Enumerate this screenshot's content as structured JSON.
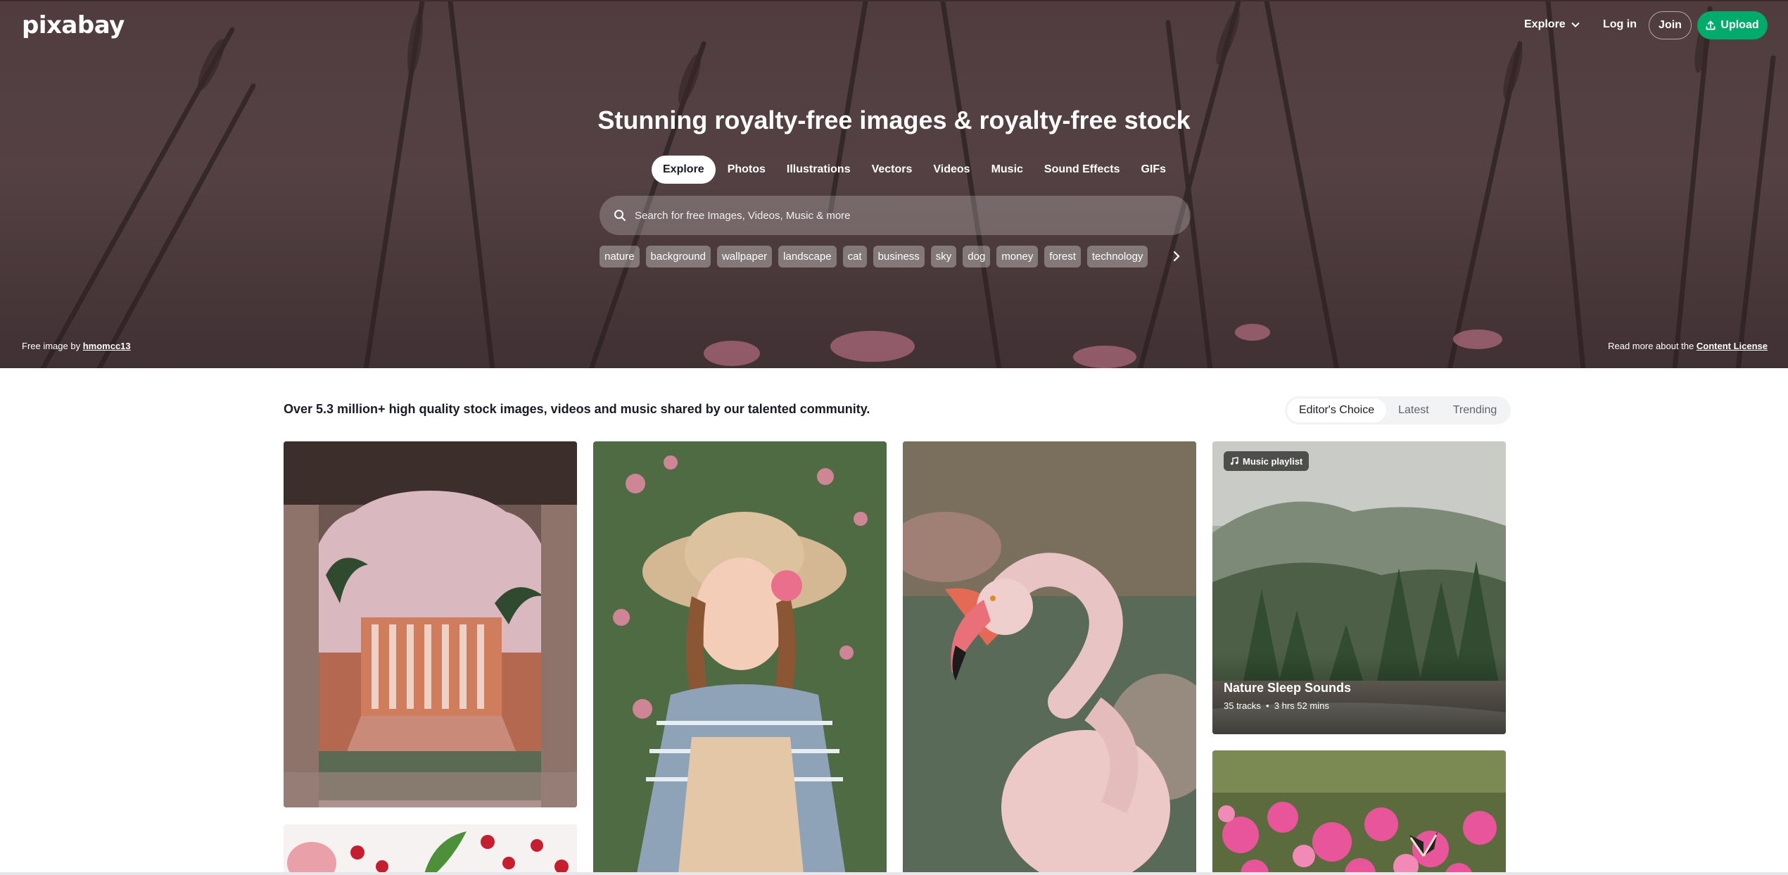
{
  "header": {
    "logo": "pixabay",
    "nav_explore": "Explore",
    "nav_login": "Log in",
    "join": "Join",
    "upload": "Upload"
  },
  "hero": {
    "title": "Stunning royalty-free images & royalty-free stock",
    "tabs": [
      "Explore",
      "Photos",
      "Illustrations",
      "Vectors",
      "Videos",
      "Music",
      "Sound Effects",
      "GIFs"
    ],
    "active_tab": "Explore",
    "search_placeholder": "Search for free Images, Videos, Music & more",
    "chips": [
      "nature",
      "background",
      "wallpaper",
      "landscape",
      "cat",
      "business",
      "sky",
      "dog",
      "money",
      "forest",
      "technology"
    ],
    "credit_prefix": "Free image by",
    "credit_user": "hmomcc13",
    "license_prefix": "Read more about the",
    "license_link": "Content License"
  },
  "content": {
    "intro": "Over 5.3 million+ high quality stock images, videos and music shared by our talented community.",
    "sort_options": [
      "Editor's Choice",
      "Latest",
      "Trending"
    ],
    "active_sort": "Editor's Choice",
    "playlist": {
      "badge": "Music playlist",
      "title": "Nature Sleep Sounds",
      "tracks": "35 tracks",
      "duration": "3 hrs 52 mins"
    }
  },
  "colors": {
    "accent": "#00ab6b",
    "hero_bg": "#5a4447",
    "text": "#191b26"
  },
  "icons": [
    "chevron-down-icon",
    "upload-icon",
    "search-icon",
    "chevron-right-icon",
    "music-note-icon"
  ]
}
